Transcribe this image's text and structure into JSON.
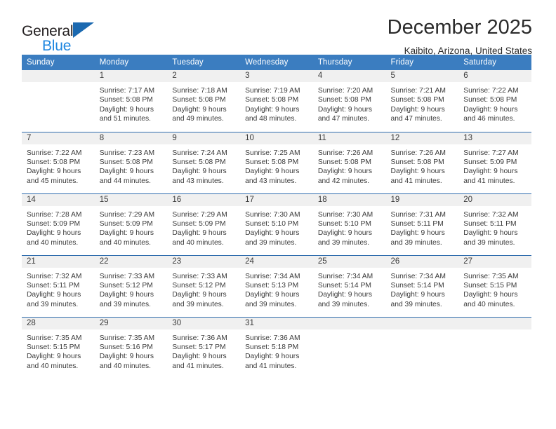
{
  "brand": {
    "name_part1": "General",
    "name_part2": "Blue",
    "accent_color": "#1b69b0",
    "blue_text_color": "#1f87e0"
  },
  "header": {
    "title": "December 2025",
    "subtitle": "Kaibito, Arizona, United States"
  },
  "theme": {
    "header_row_bg": "#3b7dc0",
    "daynum_band_bg": "#f0f0f0",
    "week_divider": "#2f6cad",
    "text_color": "#3a3a3a"
  },
  "weekday_headers": [
    "Sunday",
    "Monday",
    "Tuesday",
    "Wednesday",
    "Thursday",
    "Friday",
    "Saturday"
  ],
  "weeks": [
    [
      {
        "day": "",
        "empty": true,
        "sunrise": "",
        "sunset": "",
        "daylight_line1": "",
        "daylight_line2": ""
      },
      {
        "day": "1",
        "empty": false,
        "sunrise": "Sunrise: 7:17 AM",
        "sunset": "Sunset: 5:08 PM",
        "daylight_line1": "Daylight: 9 hours",
        "daylight_line2": "and 51 minutes."
      },
      {
        "day": "2",
        "empty": false,
        "sunrise": "Sunrise: 7:18 AM",
        "sunset": "Sunset: 5:08 PM",
        "daylight_line1": "Daylight: 9 hours",
        "daylight_line2": "and 49 minutes."
      },
      {
        "day": "3",
        "empty": false,
        "sunrise": "Sunrise: 7:19 AM",
        "sunset": "Sunset: 5:08 PM",
        "daylight_line1": "Daylight: 9 hours",
        "daylight_line2": "and 48 minutes."
      },
      {
        "day": "4",
        "empty": false,
        "sunrise": "Sunrise: 7:20 AM",
        "sunset": "Sunset: 5:08 PM",
        "daylight_line1": "Daylight: 9 hours",
        "daylight_line2": "and 47 minutes."
      },
      {
        "day": "5",
        "empty": false,
        "sunrise": "Sunrise: 7:21 AM",
        "sunset": "Sunset: 5:08 PM",
        "daylight_line1": "Daylight: 9 hours",
        "daylight_line2": "and 47 minutes."
      },
      {
        "day": "6",
        "empty": false,
        "sunrise": "Sunrise: 7:22 AM",
        "sunset": "Sunset: 5:08 PM",
        "daylight_line1": "Daylight: 9 hours",
        "daylight_line2": "and 46 minutes."
      }
    ],
    [
      {
        "day": "7",
        "empty": false,
        "sunrise": "Sunrise: 7:22 AM",
        "sunset": "Sunset: 5:08 PM",
        "daylight_line1": "Daylight: 9 hours",
        "daylight_line2": "and 45 minutes."
      },
      {
        "day": "8",
        "empty": false,
        "sunrise": "Sunrise: 7:23 AM",
        "sunset": "Sunset: 5:08 PM",
        "daylight_line1": "Daylight: 9 hours",
        "daylight_line2": "and 44 minutes."
      },
      {
        "day": "9",
        "empty": false,
        "sunrise": "Sunrise: 7:24 AM",
        "sunset": "Sunset: 5:08 PM",
        "daylight_line1": "Daylight: 9 hours",
        "daylight_line2": "and 43 minutes."
      },
      {
        "day": "10",
        "empty": false,
        "sunrise": "Sunrise: 7:25 AM",
        "sunset": "Sunset: 5:08 PM",
        "daylight_line1": "Daylight: 9 hours",
        "daylight_line2": "and 43 minutes."
      },
      {
        "day": "11",
        "empty": false,
        "sunrise": "Sunrise: 7:26 AM",
        "sunset": "Sunset: 5:08 PM",
        "daylight_line1": "Daylight: 9 hours",
        "daylight_line2": "and 42 minutes."
      },
      {
        "day": "12",
        "empty": false,
        "sunrise": "Sunrise: 7:26 AM",
        "sunset": "Sunset: 5:08 PM",
        "daylight_line1": "Daylight: 9 hours",
        "daylight_line2": "and 41 minutes."
      },
      {
        "day": "13",
        "empty": false,
        "sunrise": "Sunrise: 7:27 AM",
        "sunset": "Sunset: 5:09 PM",
        "daylight_line1": "Daylight: 9 hours",
        "daylight_line2": "and 41 minutes."
      }
    ],
    [
      {
        "day": "14",
        "empty": false,
        "sunrise": "Sunrise: 7:28 AM",
        "sunset": "Sunset: 5:09 PM",
        "daylight_line1": "Daylight: 9 hours",
        "daylight_line2": "and 40 minutes."
      },
      {
        "day": "15",
        "empty": false,
        "sunrise": "Sunrise: 7:29 AM",
        "sunset": "Sunset: 5:09 PM",
        "daylight_line1": "Daylight: 9 hours",
        "daylight_line2": "and 40 minutes."
      },
      {
        "day": "16",
        "empty": false,
        "sunrise": "Sunrise: 7:29 AM",
        "sunset": "Sunset: 5:09 PM",
        "daylight_line1": "Daylight: 9 hours",
        "daylight_line2": "and 40 minutes."
      },
      {
        "day": "17",
        "empty": false,
        "sunrise": "Sunrise: 7:30 AM",
        "sunset": "Sunset: 5:10 PM",
        "daylight_line1": "Daylight: 9 hours",
        "daylight_line2": "and 39 minutes."
      },
      {
        "day": "18",
        "empty": false,
        "sunrise": "Sunrise: 7:30 AM",
        "sunset": "Sunset: 5:10 PM",
        "daylight_line1": "Daylight: 9 hours",
        "daylight_line2": "and 39 minutes."
      },
      {
        "day": "19",
        "empty": false,
        "sunrise": "Sunrise: 7:31 AM",
        "sunset": "Sunset: 5:11 PM",
        "daylight_line1": "Daylight: 9 hours",
        "daylight_line2": "and 39 minutes."
      },
      {
        "day": "20",
        "empty": false,
        "sunrise": "Sunrise: 7:32 AM",
        "sunset": "Sunset: 5:11 PM",
        "daylight_line1": "Daylight: 9 hours",
        "daylight_line2": "and 39 minutes."
      }
    ],
    [
      {
        "day": "21",
        "empty": false,
        "sunrise": "Sunrise: 7:32 AM",
        "sunset": "Sunset: 5:11 PM",
        "daylight_line1": "Daylight: 9 hours",
        "daylight_line2": "and 39 minutes."
      },
      {
        "day": "22",
        "empty": false,
        "sunrise": "Sunrise: 7:33 AM",
        "sunset": "Sunset: 5:12 PM",
        "daylight_line1": "Daylight: 9 hours",
        "daylight_line2": "and 39 minutes."
      },
      {
        "day": "23",
        "empty": false,
        "sunrise": "Sunrise: 7:33 AM",
        "sunset": "Sunset: 5:12 PM",
        "daylight_line1": "Daylight: 9 hours",
        "daylight_line2": "and 39 minutes."
      },
      {
        "day": "24",
        "empty": false,
        "sunrise": "Sunrise: 7:34 AM",
        "sunset": "Sunset: 5:13 PM",
        "daylight_line1": "Daylight: 9 hours",
        "daylight_line2": "and 39 minutes."
      },
      {
        "day": "25",
        "empty": false,
        "sunrise": "Sunrise: 7:34 AM",
        "sunset": "Sunset: 5:14 PM",
        "daylight_line1": "Daylight: 9 hours",
        "daylight_line2": "and 39 minutes."
      },
      {
        "day": "26",
        "empty": false,
        "sunrise": "Sunrise: 7:34 AM",
        "sunset": "Sunset: 5:14 PM",
        "daylight_line1": "Daylight: 9 hours",
        "daylight_line2": "and 39 minutes."
      },
      {
        "day": "27",
        "empty": false,
        "sunrise": "Sunrise: 7:35 AM",
        "sunset": "Sunset: 5:15 PM",
        "daylight_line1": "Daylight: 9 hours",
        "daylight_line2": "and 40 minutes."
      }
    ],
    [
      {
        "day": "28",
        "empty": false,
        "sunrise": "Sunrise: 7:35 AM",
        "sunset": "Sunset: 5:15 PM",
        "daylight_line1": "Daylight: 9 hours",
        "daylight_line2": "and 40 minutes."
      },
      {
        "day": "29",
        "empty": false,
        "sunrise": "Sunrise: 7:35 AM",
        "sunset": "Sunset: 5:16 PM",
        "daylight_line1": "Daylight: 9 hours",
        "daylight_line2": "and 40 minutes."
      },
      {
        "day": "30",
        "empty": false,
        "sunrise": "Sunrise: 7:36 AM",
        "sunset": "Sunset: 5:17 PM",
        "daylight_line1": "Daylight: 9 hours",
        "daylight_line2": "and 41 minutes."
      },
      {
        "day": "31",
        "empty": false,
        "sunrise": "Sunrise: 7:36 AM",
        "sunset": "Sunset: 5:18 PM",
        "daylight_line1": "Daylight: 9 hours",
        "daylight_line2": "and 41 minutes."
      },
      {
        "day": "",
        "empty": true,
        "sunrise": "",
        "sunset": "",
        "daylight_line1": "",
        "daylight_line2": ""
      },
      {
        "day": "",
        "empty": true,
        "sunrise": "",
        "sunset": "",
        "daylight_line1": "",
        "daylight_line2": ""
      },
      {
        "day": "",
        "empty": true,
        "sunrise": "",
        "sunset": "",
        "daylight_line1": "",
        "daylight_line2": ""
      }
    ]
  ]
}
